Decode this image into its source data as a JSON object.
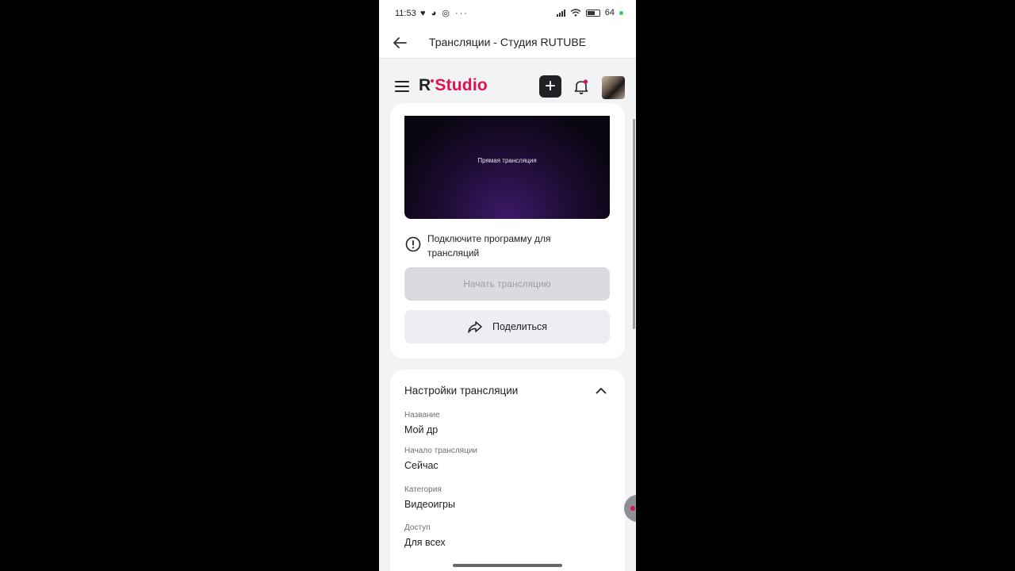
{
  "status_bar": {
    "time": "11:53",
    "app_icons": "♥ ◕ ◎ ···",
    "battery": "64"
  },
  "title_bar": {
    "title": "Трансляции - Студия RUTUBE"
  },
  "app_header": {
    "logo_r": "R",
    "logo_studio": "Studio",
    "add_label": "+"
  },
  "preview": {
    "label": "Прямая трансляция"
  },
  "stream_card": {
    "warning": "Подключите программу для трансляций",
    "start_button": "Начать трансляцию",
    "share_button": "Поделиться"
  },
  "settings": {
    "title": "Настройки трансляции",
    "fields": [
      {
        "label": "Название",
        "value": "Мой др"
      },
      {
        "label": "Начало трансляции",
        "value": "Сейчас"
      },
      {
        "label": "Категория",
        "value": "Видеоигры"
      },
      {
        "label": "Доступ",
        "value": "Для всех"
      }
    ]
  },
  "colors": {
    "brand": "#e0114f",
    "background": "#f2f3f5",
    "dark": "#1f2125"
  }
}
